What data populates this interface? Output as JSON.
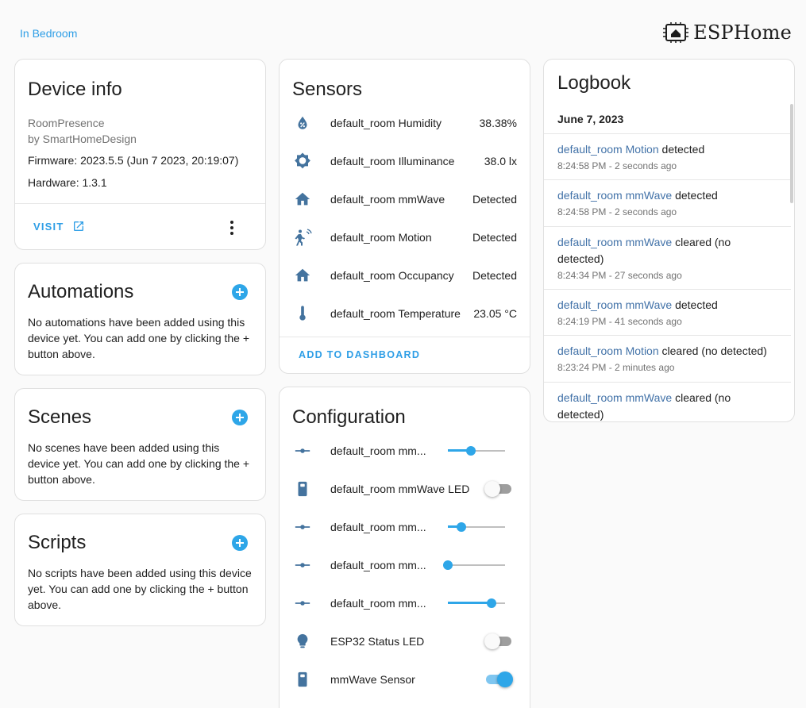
{
  "breadcrumb": {
    "area": "In Bedroom"
  },
  "brand": {
    "name": "ESPHome"
  },
  "device_info": {
    "title": "Device info",
    "model": "RoomPresence",
    "manufacturer": "by SmartHomeDesign",
    "firmware": "Firmware: 2023.5.5 (Jun 7 2023, 20:19:07)",
    "hardware": "Hardware: 1.3.1",
    "visit_label": "VISIT"
  },
  "automations": {
    "title": "Automations",
    "empty_text": "No automations have been added using this device yet. You can add one by clicking the + button above."
  },
  "scenes": {
    "title": "Scenes",
    "empty_text": "No scenes have been added using this device yet. You can add one by clicking the + button above."
  },
  "scripts": {
    "title": "Scripts",
    "empty_text": "No scripts have been added using this device yet. You can add one by clicking the + button above."
  },
  "sensors": {
    "title": "Sensors",
    "items": [
      {
        "name": "default_room Humidity",
        "value": "38.38%",
        "icon": "water-percent-icon"
      },
      {
        "name": "default_room Illuminance",
        "value": "38.0 lx",
        "icon": "brightness-icon"
      },
      {
        "name": "default_room mmWave",
        "value": "Detected",
        "icon": "home-icon"
      },
      {
        "name": "default_room Motion",
        "value": "Detected",
        "icon": "motion-sensor-icon"
      },
      {
        "name": "default_room Occupancy",
        "value": "Detected",
        "icon": "home-icon"
      },
      {
        "name": "default_room Temperature",
        "value": "23.05 °C",
        "icon": "thermometer-icon"
      }
    ],
    "add_to_dashboard_label": "ADD TO DASHBOARD"
  },
  "configuration": {
    "title": "Configuration",
    "items": [
      {
        "name": "default_room mm...",
        "control": "slider",
        "level": 0.4,
        "icon": "ray-vertex-icon"
      },
      {
        "name": "default_room mmWave LED",
        "control": "toggle",
        "on": false,
        "icon": "remote-icon"
      },
      {
        "name": "default_room mm...",
        "control": "slider",
        "level": 0.23,
        "icon": "ray-vertex-icon"
      },
      {
        "name": "default_room mm...",
        "control": "slider",
        "level": 0.0,
        "icon": "ray-vertex-icon"
      },
      {
        "name": "default_room mm...",
        "control": "slider",
        "level": 0.77,
        "icon": "ray-vertex-icon"
      },
      {
        "name": "ESP32 Status LED",
        "control": "toggle",
        "on": false,
        "icon": "lightbulb-icon"
      },
      {
        "name": "mmWave Sensor",
        "control": "toggle",
        "on": true,
        "icon": "remote-icon"
      }
    ]
  },
  "logbook": {
    "title": "Logbook",
    "date": "June 7, 2023",
    "entries": [
      {
        "entity": "default_room Motion",
        "message": " detected",
        "time": "8:24:58 PM - 2 seconds ago"
      },
      {
        "entity": "default_room mmWave",
        "message": " detected",
        "time": "8:24:58 PM - 2 seconds ago"
      },
      {
        "entity": "default_room mmWave",
        "message": " cleared (no detected)",
        "time": "8:24:34 PM - 27 seconds ago"
      },
      {
        "entity": "default_room mmWave",
        "message": " detected",
        "time": "8:24:19 PM - 41 seconds ago"
      },
      {
        "entity": "default_room Motion",
        "message": " cleared (no detected)",
        "time": "8:23:24 PM - 2 minutes ago"
      },
      {
        "entity": "default_room mmWave",
        "message": " cleared (no detected)",
        "time": ""
      }
    ]
  },
  "colors": {
    "accent": "#2ea6e8",
    "link": "#2e9ee6",
    "icon": "#44739e",
    "logbook_entity": "#4272a8"
  }
}
